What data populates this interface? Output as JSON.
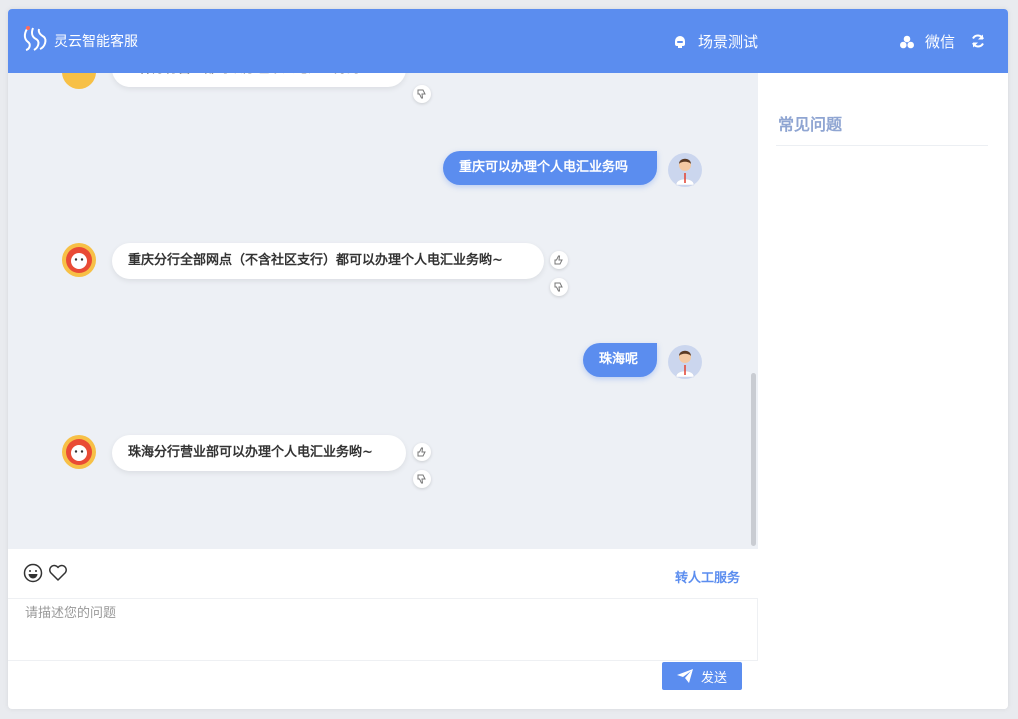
{
  "header": {
    "app_title": "灵云智能客服",
    "scene_label": "场景测试",
    "wechat_label": "微信",
    "icons": [
      "logo-icon",
      "robot-icon",
      "wechat-icon",
      "refresh-icon"
    ],
    "color": "#5b8def"
  },
  "messages": [
    {
      "from": "bot",
      "text": "~韩分行营业部可以办理个人电汇业务的~"
    },
    {
      "from": "user",
      "text": "重庆可以办理个人电汇业务吗"
    },
    {
      "from": "bot",
      "text": "重庆分行全部网点（不含社区支行）都可以办理个人电汇业务哟~"
    },
    {
      "from": "user",
      "text": "珠海呢"
    },
    {
      "from": "bot",
      "text": "珠海分行营业部可以办理个人电汇业务哟~"
    }
  ],
  "toolbar": {
    "icons": [
      "emoji-icon",
      "heart-icon"
    ],
    "human_service": "转人工服务"
  },
  "input": {
    "placeholder": "请描述您的问题",
    "value": ""
  },
  "send": {
    "label": "发送",
    "icon": "paper-plane-icon"
  },
  "faq": {
    "title": "常见问题"
  }
}
